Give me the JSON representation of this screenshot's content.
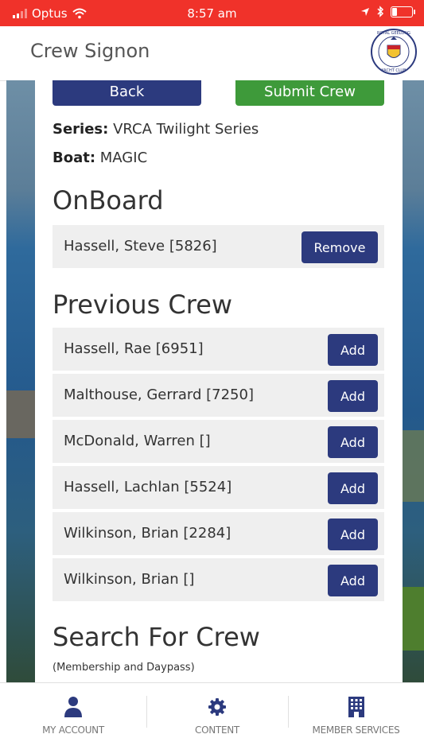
{
  "status_bar": {
    "carrier": "Optus",
    "time": "8:57 am"
  },
  "header": {
    "title": "Crew Signon",
    "logo_text": "ROYAL GEELONG YACHT CLUB"
  },
  "actions": {
    "back_label": "Back",
    "submit_label": "Submit Crew"
  },
  "meta": {
    "series_label": "Series:",
    "series_value": "VRCA Twilight Series",
    "boat_label": "Boat:",
    "boat_value": "MAGIC"
  },
  "onboard": {
    "title": "OnBoard",
    "members": [
      {
        "name": "Hassell, Steve [5826]",
        "action": "Remove"
      }
    ]
  },
  "previous_crew": {
    "title": "Previous Crew",
    "members": [
      {
        "name": "Hassell, Rae [6951]",
        "action": "Add"
      },
      {
        "name": "Malthouse, Gerrard [7250]",
        "action": "Add"
      },
      {
        "name": "McDonald, Warren []",
        "action": "Add"
      },
      {
        "name": "Hassell, Lachlan [5524]",
        "action": "Add"
      },
      {
        "name": "Wilkinson, Brian [2284]",
        "action": "Add"
      },
      {
        "name": "Wilkinson, Brian []",
        "action": "Add"
      }
    ]
  },
  "search": {
    "title": "Search For Crew",
    "subtitle": "(Membership and Daypass)"
  },
  "tabbar": {
    "items": [
      {
        "label": "MY ACCOUNT",
        "icon": "user-icon"
      },
      {
        "label": "CONTENT",
        "icon": "gear-icon"
      },
      {
        "label": "MEMBER SERVICES",
        "icon": "building-icon"
      }
    ]
  },
  "colors": {
    "status_bar": "#f0322a",
    "primary_button": "#2c3a7e",
    "submit_button": "#3e9a3a",
    "row_background": "#efefef"
  }
}
